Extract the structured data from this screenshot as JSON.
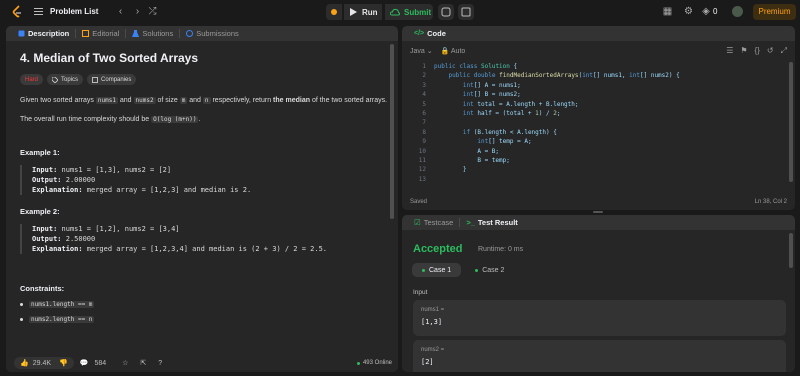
{
  "topbar": {
    "title": "Problem List",
    "run_label": "Run",
    "submit_label": "Submit",
    "streak": "0",
    "premium_label": "Premium"
  },
  "left": {
    "tabs": [
      {
        "label": "Description"
      },
      {
        "label": "Editorial"
      },
      {
        "label": "Solutions"
      },
      {
        "label": "Submissions"
      }
    ],
    "title": "4. Median of Two Sorted Arrays",
    "difficulty": "Hard",
    "tag_topics": "Topics",
    "tag_companies": "Companies",
    "desc": {
      "p1_a": "Given two sorted arrays ",
      "p1_code1": "nums1",
      "p1_b": " and ",
      "p1_code2": "nums2",
      "p1_c": " of size ",
      "p1_code3": "m",
      "p1_d": " and ",
      "p1_code4": "n",
      "p1_e": " respectively, return ",
      "p1_bold": "the median",
      "p1_f": " of the two sorted arrays.",
      "p2_a": "The overall run time complexity should be ",
      "p2_code": "O(log (m+n))",
      "p2_b": "."
    },
    "examples": [
      {
        "title": "Example 1:",
        "input_label": "Input:",
        "input": " nums1 = [1,3], nums2 = [2]",
        "output_label": "Output:",
        "output": " 2.00000",
        "expl_label": "Explanation:",
        "expl": " merged array = [1,2,3] and median is 2."
      },
      {
        "title": "Example 2:",
        "input_label": "Input:",
        "input": " nums1 = [1,2], nums2 = [3,4]",
        "output_label": "Output:",
        "output": " 2.50000",
        "expl_label": "Explanation:",
        "expl": " merged array = [1,2,3,4] and median is (2 + 3) / 2 = 2.5."
      }
    ],
    "constraints_title": "Constraints:",
    "constraints": [
      "nums1.length == m",
      "nums2.length == n"
    ],
    "bottom": {
      "likes": "29.4K",
      "comments": "584",
      "online": "493 Online"
    }
  },
  "code": {
    "tab_label": "Code",
    "lang": "Java",
    "auto_label": "Auto",
    "saved": "Saved",
    "cursor_pos": "Ln 38, Col 2",
    "lines": [
      {
        "n": "1",
        "t": "public class Solution {"
      },
      {
        "n": "2",
        "t": "    public double findMedianSortedArrays(int[] nums1, int[] nums2) {"
      },
      {
        "n": "3",
        "t": "        int[] A = nums1;"
      },
      {
        "n": "4",
        "t": "        int[] B = nums2;"
      },
      {
        "n": "5",
        "t": "        int total = A.length + B.length;"
      },
      {
        "n": "6",
        "t": "        int half = (total + 1) / 2;"
      },
      {
        "n": "7",
        "t": ""
      },
      {
        "n": "8",
        "t": "        if (B.length < A.length) {"
      },
      {
        "n": "9",
        "t": "            int[] temp = A;"
      },
      {
        "n": "10",
        "t": "            A = B;"
      },
      {
        "n": "11",
        "t": "            B = temp;"
      },
      {
        "n": "12",
        "t": "        }"
      },
      {
        "n": "13",
        "t": ""
      }
    ]
  },
  "result": {
    "testcase_tab": "Testcase",
    "result_tab": "Test Result",
    "status": "Accepted",
    "runtime": "Runtime: 0 ms",
    "case1": "Case 1",
    "case2": "Case 2",
    "input_label": "Input",
    "fields": [
      {
        "label": "nums1 =",
        "value": "[1,3]"
      },
      {
        "label": "nums2 =",
        "value": "[2]"
      }
    ]
  },
  "colors": {
    "accent_green": "#2cbb5d",
    "hard_red": "#f63636",
    "premium_orange": "#ffa116"
  }
}
